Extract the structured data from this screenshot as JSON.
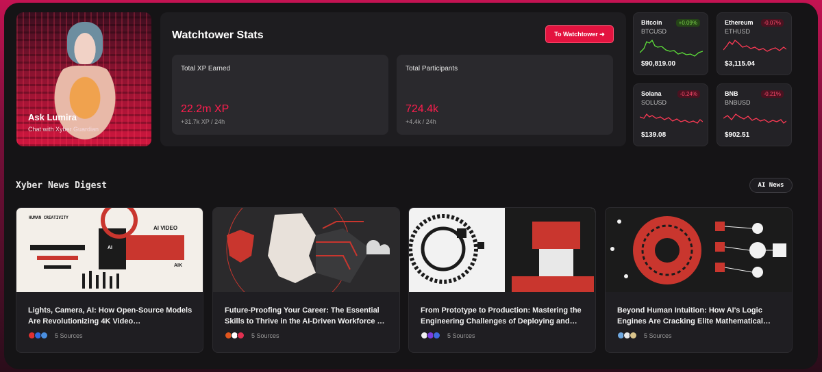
{
  "lumira": {
    "title": "Ask Lumira",
    "subtitle": "Chat with Xyber Guardian"
  },
  "stats": {
    "title": "Watchtower Stats",
    "cta_label": "To Watchtower ➜",
    "xp": {
      "label": "Total XP Earned",
      "value": "22.2m XP",
      "delta": "+31.7k XP / 24h"
    },
    "participants": {
      "label": "Total Participants",
      "value": "724.4k",
      "delta": "+4.4k / 24h"
    }
  },
  "coins": [
    {
      "name": "Bitcoin",
      "symbol": "BTCUSD",
      "change": "+0.09%",
      "price": "$90,819.00",
      "trend": "up",
      "color": "#5ee23a"
    },
    {
      "name": "Ethereum",
      "symbol": "ETHUSD",
      "change": "-0.07%",
      "price": "$3,115.04",
      "trend": "down",
      "color": "#ff3a55"
    },
    {
      "name": "Solana",
      "symbol": "SOLUSD",
      "change": "-0.24%",
      "price": "$139.08",
      "trend": "down",
      "color": "#ff3a55"
    },
    {
      "name": "BNB",
      "symbol": "BNBUSD",
      "change": "-0.21%",
      "price": "$902.51",
      "trend": "down",
      "color": "#ff3a55"
    }
  ],
  "news": {
    "title": "Xyber News Digest",
    "tag": "AI News",
    "articles": [
      {
        "title": "Lights, Camera, AI: How Open-Source Models Are Revolutionizing 4K Video…",
        "sources": "5 Sources",
        "image_text_a": "HUMAN CREATIVITY",
        "image_text_b": "AI VIDEO",
        "image_text_c": "AIK",
        "image_text_d": "AI"
      },
      {
        "title": "Future-Proofing Your Career: The Essential Skills to Thrive in the AI-Driven Workforce …",
        "sources": "5 Sources"
      },
      {
        "title": "From Prototype to Production: Mastering the Engineering Challenges of Deploying and…",
        "sources": "5 Sources"
      },
      {
        "title": "Beyond Human Intuition: How AI's Logic Engines Are Cracking Elite Mathematical…",
        "sources": "5 Sources"
      }
    ]
  },
  "colors": {
    "accent": "#e3133f",
    "background": "#151416",
    "card": "#1f1e22",
    "up": "#5ee23a",
    "down": "#ff3a55"
  }
}
